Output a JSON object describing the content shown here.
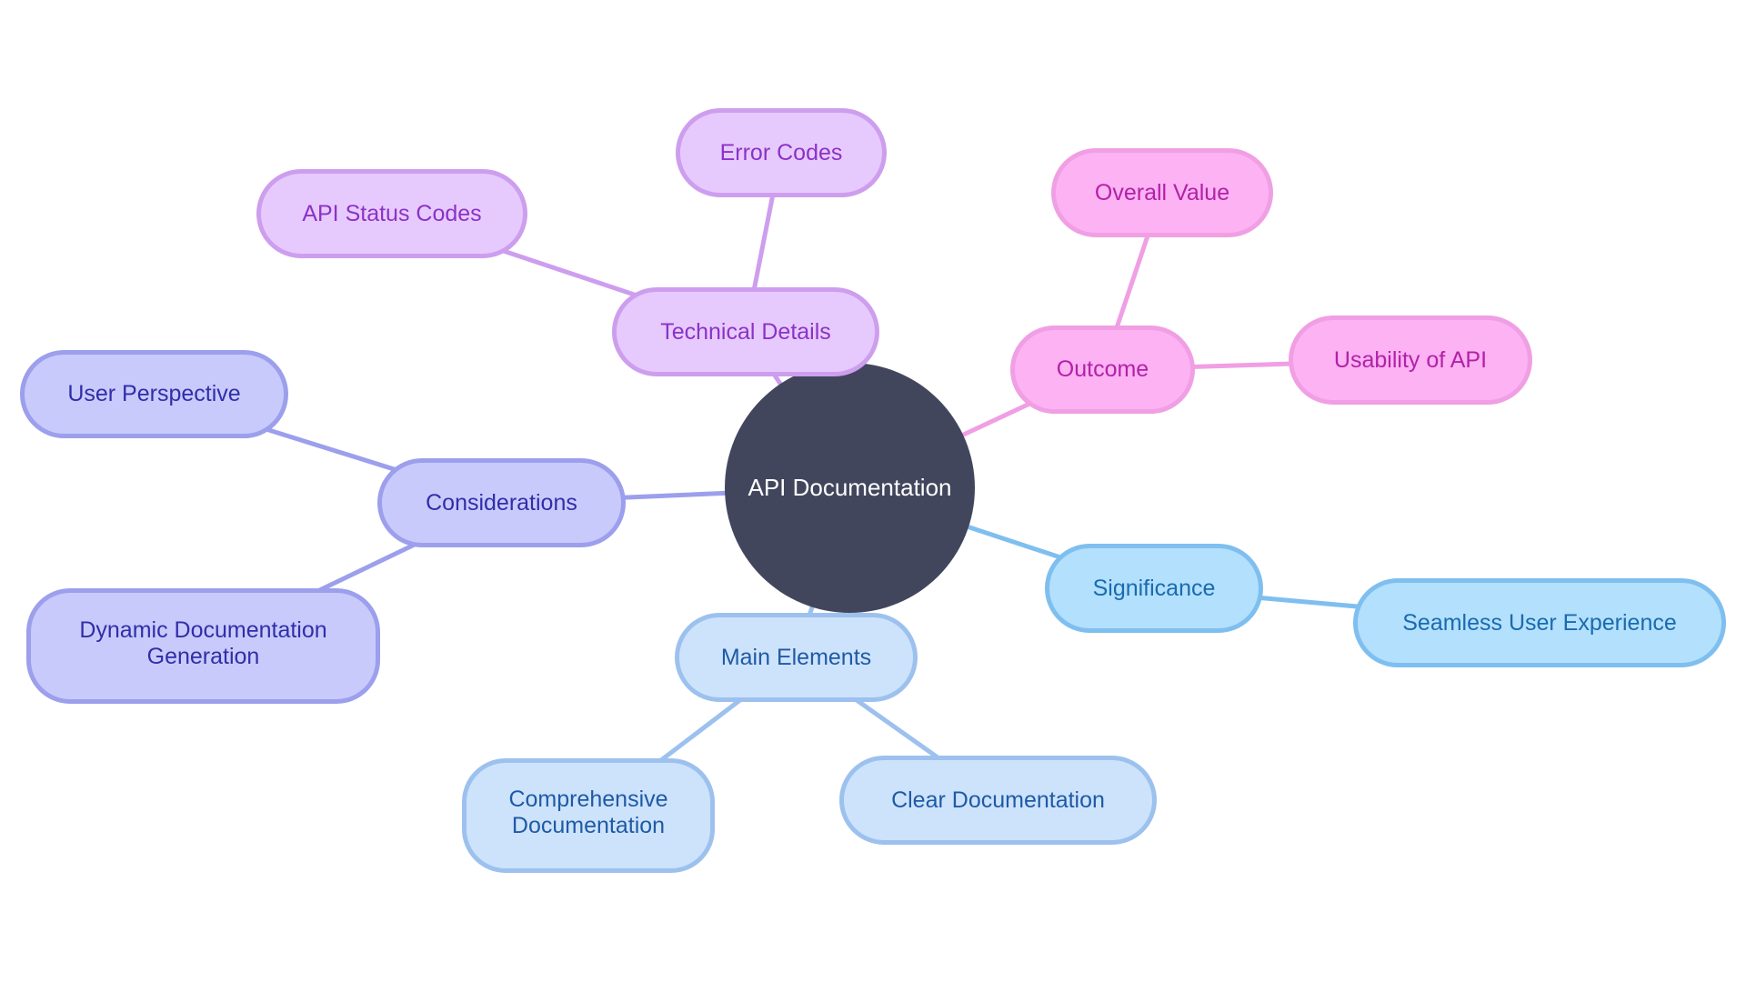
{
  "diagram": {
    "type": "mindmap",
    "root": {
      "id": "root",
      "label": "API Documentation",
      "color": "#42465D",
      "text_color": "#FFFFFF"
    },
    "branches": [
      {
        "id": "tech",
        "label": "Technical Details",
        "colors": {
          "fill": "#E7CAFD",
          "stroke": "#CE9EEE",
          "text": "#8B32C7"
        },
        "children": [
          {
            "id": "status",
            "label": "API Status Codes"
          },
          {
            "id": "err",
            "label": "Error Codes"
          }
        ]
      },
      {
        "id": "outcome",
        "label": "Outcome",
        "colors": {
          "fill": "#FDB2F3",
          "stroke": "#F09FE4",
          "text": "#B221A8"
        },
        "children": [
          {
            "id": "overall",
            "label": "Overall Value"
          },
          {
            "id": "usab",
            "label": "Usability of API"
          }
        ]
      },
      {
        "id": "sig",
        "label": "Significance",
        "colors": {
          "fill": "#B3E0FD",
          "stroke": "#7FBFEF",
          "text": "#1A6BAE"
        },
        "children": [
          {
            "id": "seam",
            "label": "Seamless User Experience"
          }
        ]
      },
      {
        "id": "main",
        "label": "Main Elements",
        "colors": {
          "fill": "#CDE3FB",
          "stroke": "#9DC1EE",
          "text": "#1F5AA6"
        },
        "children": [
          {
            "id": "comp",
            "label": "Comprehensive\nDocumentation"
          },
          {
            "id": "clear",
            "label": "Clear Documentation"
          }
        ]
      },
      {
        "id": "cons",
        "label": "Considerations",
        "colors": {
          "fill": "#C9CAFC",
          "stroke": "#9C9FEC",
          "text": "#2F2FA8"
        },
        "children": [
          {
            "id": "user",
            "label": "User Perspective"
          },
          {
            "id": "dyn",
            "label": "Dynamic Documentation\nGeneration"
          }
        ]
      }
    ]
  }
}
